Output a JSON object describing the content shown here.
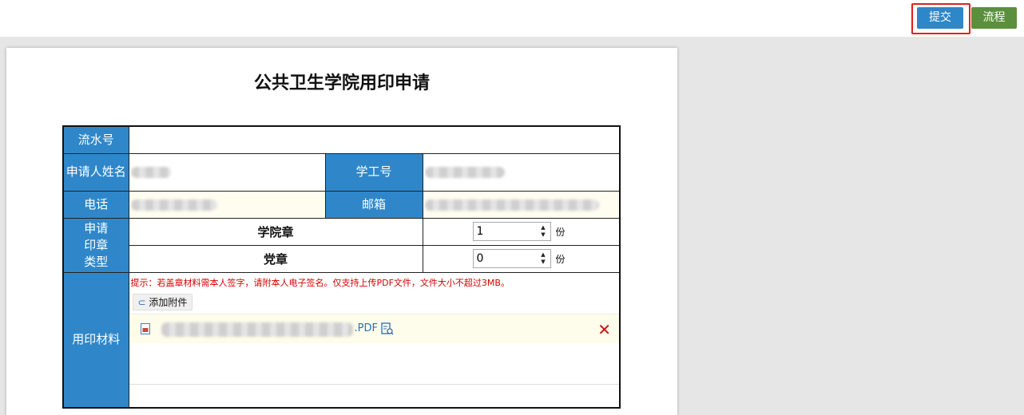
{
  "toolbar": {
    "submit_label": "提交",
    "flow_label": "流程"
  },
  "form": {
    "title": "公共卫生学院用印申请",
    "serial_label": "流水号",
    "applicant_label": "申请人姓名",
    "staff_id_label": "学工号",
    "phone_label": "电话",
    "email_label": "邮箱",
    "seal_type_label": "申请印章类型",
    "seals": [
      {
        "name": "学院章",
        "value": "1",
        "unit": "份"
      },
      {
        "name": "党章",
        "value": "0",
        "unit": "份"
      }
    ],
    "material_label": "用印材料",
    "hint": "提示：若盖章材料需本人签字，请附本人电子签名。仅支持上传PDF文件，文件大小不超过3MB。",
    "attach_button": "添加附件",
    "file_ext": ".PDF"
  },
  "icons": {
    "attach": "paperclip-icon",
    "file": "pdf-file-icon",
    "preview": "preview-icon",
    "delete": "delete-x-icon"
  },
  "colors": {
    "label_bg": "#2f87c9",
    "submit": "#2e87c8",
    "flow": "#5a8f3e",
    "highlight": "#e0201c",
    "hint": "#d40000"
  }
}
